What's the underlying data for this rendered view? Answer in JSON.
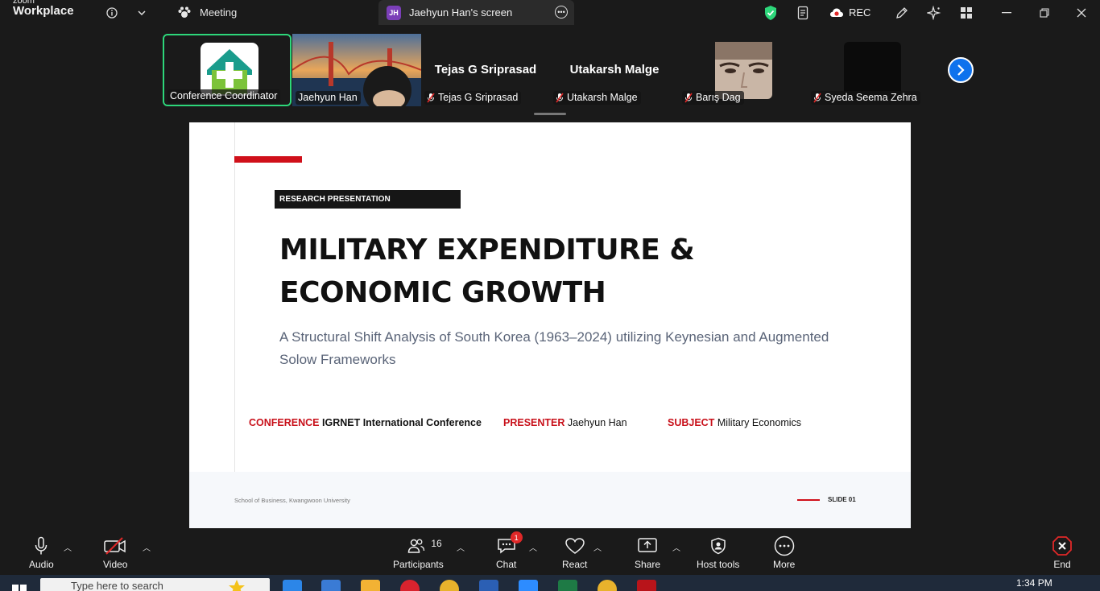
{
  "app": {
    "brand_line1": "zoom",
    "brand_line2": "Workplace"
  },
  "tabs": [
    {
      "label": "Meeting"
    },
    {
      "label": "Jaehyun Han's screen",
      "badge": "JH"
    }
  ],
  "titlebar": {
    "rec_label": "REC"
  },
  "participants": [
    {
      "name": "Conference Coordinator",
      "muted": false,
      "active": true
    },
    {
      "name": "Jaehyun Han",
      "muted": false
    },
    {
      "name": "Tejas G Sriprasad",
      "display": "Tejas G Sriprasad",
      "muted": true
    },
    {
      "name": "Utakarsh Malge",
      "display": "Utakarsh Malge",
      "muted": true
    },
    {
      "name": "Barış Dag",
      "muted": true
    },
    {
      "name": "Syeda Seema Zehra",
      "muted": true
    }
  ],
  "slide": {
    "label": "RESEARCH PRESENTATION",
    "title_line1": "MILITARY EXPENDITURE &",
    "title_line2": "ECONOMIC GROWTH",
    "subtitle_line1": "A Structural Shift Analysis of South Korea (1963–2024) utilizing Keynesian and Augmented",
    "subtitle_line2": "Solow Frameworks",
    "conference_key": "CONFERENCE",
    "conference_val": "IGRNET International Conference",
    "presenter_key": "PRESENTER",
    "presenter_val": "Jaehyun Han",
    "subject_key": "SUBJECT",
    "subject_val": "Military Economics",
    "footer_school": "School of Business, Kwangwoon University",
    "footer_slide": "SLIDE 01"
  },
  "toolbar": {
    "audio": "Audio",
    "video": "Video",
    "participants": "Participants",
    "participants_count": "16",
    "chat": "Chat",
    "chat_badge": "1",
    "react": "React",
    "share": "Share",
    "host_tools": "Host tools",
    "more": "More",
    "end": "End"
  },
  "taskbar": {
    "search_placeholder": "Type here to search",
    "time": "1:34 PM"
  },
  "colors": {
    "accent_green": "#2dd67a",
    "zoom_blue": "#0e72ed",
    "slide_red": "#d0101a",
    "end_red": "#e02828"
  }
}
